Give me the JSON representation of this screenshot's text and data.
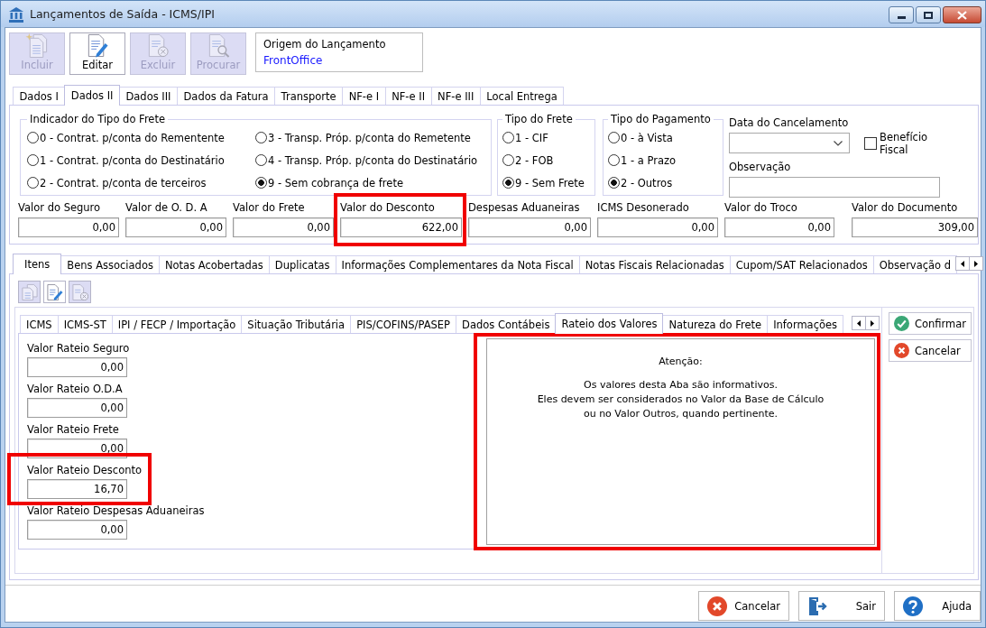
{
  "window": {
    "title": "Lançamentos de Saída - ICMS/IPI"
  },
  "toolbar": [
    {
      "label": "Incluir",
      "kind": "add",
      "disabled": true
    },
    {
      "label": "Editar",
      "kind": "edit",
      "disabled": false
    },
    {
      "label": "Excluir",
      "kind": "delete",
      "disabled": true
    },
    {
      "label": "Procurar",
      "kind": "search",
      "disabled": true
    }
  ],
  "origin": {
    "label": "Origem do Lançamento",
    "value": "FrontOffice"
  },
  "main_tabs": [
    {
      "label": "Dados I",
      "selected": false
    },
    {
      "label": "Dados II",
      "selected": true
    },
    {
      "label": "Dados III",
      "selected": false
    },
    {
      "label": "Dados da Fatura",
      "selected": false
    },
    {
      "label": "Transporte",
      "selected": false
    },
    {
      "label": "NF-e I",
      "selected": false
    },
    {
      "label": "NF-e II",
      "selected": false
    },
    {
      "label": "NF-e III",
      "selected": false
    },
    {
      "label": "Local Entrega",
      "selected": false
    }
  ],
  "freight_indicator": {
    "title": "Indicador do Tipo do Frete",
    "options": [
      {
        "label": "0 - Contrat. p/conta do Rementente",
        "selected": false
      },
      {
        "label": "1 - Contrat. p/conta do Destinatário",
        "selected": false
      },
      {
        "label": "2 - Contrat. p/conta de terceiros",
        "selected": false
      },
      {
        "label": "3 - Transp. Próp. p/conta do Remetente",
        "selected": false
      },
      {
        "label": "4 - Transp. Próp. p/conta do Destinatário",
        "selected": false
      },
      {
        "label": "9 - Sem cobrança de frete",
        "selected": true
      }
    ]
  },
  "freight_type": {
    "title": "Tipo do Frete",
    "options": [
      {
        "label": "1 - CIF",
        "selected": false
      },
      {
        "label": "2 - FOB",
        "selected": false
      },
      {
        "label": "9 - Sem Frete",
        "selected": true
      }
    ]
  },
  "payment_type": {
    "title": "Tipo do Pagamento",
    "options": [
      {
        "label": "0 - à Vista",
        "selected": false
      },
      {
        "label": "1 - a Prazo",
        "selected": false
      },
      {
        "label": "2 - Outros",
        "selected": true
      }
    ]
  },
  "cancel_date": {
    "label": "Data do Cancelamento"
  },
  "tax_benefit": {
    "label": "Benefício Fiscal",
    "checked": false
  },
  "observation": {
    "label": "Observação"
  },
  "totals": [
    {
      "label": "Valor do Seguro",
      "value": "0,00",
      "highlighted": false
    },
    {
      "label": "Valor de O. D. A",
      "value": "0,00",
      "highlighted": false
    },
    {
      "label": "Valor do Frete",
      "value": "0,00",
      "highlighted": false
    },
    {
      "label": "Valor do Desconto",
      "value": "622,00",
      "highlighted": true
    },
    {
      "label": "Despesas Aduaneiras",
      "value": "0,00",
      "highlighted": false
    },
    {
      "label": "ICMS Desonerado",
      "value": "0,00",
      "highlighted": false
    },
    {
      "label": "Valor do Troco",
      "value": "0,00",
      "highlighted": false
    },
    {
      "label": "Valor do Documento",
      "value": "309,00",
      "highlighted": false
    }
  ],
  "item_tabs": [
    {
      "label": "Itens",
      "selected": true
    },
    {
      "label": "Bens Associados",
      "selected": false
    },
    {
      "label": "Notas Acobertadas",
      "selected": false
    },
    {
      "label": "Duplicatas",
      "selected": false
    },
    {
      "label": "Informações Complementares da Nota Fiscal",
      "selected": false
    },
    {
      "label": "Notas Fiscais Relacionadas",
      "selected": false
    },
    {
      "label": "Cupom/SAT Relacionados",
      "selected": false
    },
    {
      "label": "Observação d",
      "selected": false
    }
  ],
  "item_toolbar": [
    {
      "kind": "add",
      "disabled": true
    },
    {
      "kind": "edit",
      "disabled": false
    },
    {
      "kind": "delete",
      "disabled": true
    }
  ],
  "tax_tabs": [
    {
      "label": "ICMS",
      "selected": false
    },
    {
      "label": "ICMS-ST",
      "selected": false
    },
    {
      "label": "IPI / FECP / Importação",
      "selected": false
    },
    {
      "label": "Situação Tributária",
      "selected": false
    },
    {
      "label": "PIS/COFINS/PASEP",
      "selected": false
    },
    {
      "label": "Dados Contábeis",
      "selected": false
    },
    {
      "label": "Rateio dos Valores",
      "selected": true
    },
    {
      "label": "Natureza do Frete",
      "selected": false
    },
    {
      "label": "Informações",
      "selected": false
    }
  ],
  "apportionment": [
    {
      "label": "Valor Rateio Seguro",
      "value": "0,00",
      "highlighted": false
    },
    {
      "label": "Valor Rateio O.D.A",
      "value": "0,00",
      "highlighted": false
    },
    {
      "label": "Valor Rateio Frete",
      "value": "0,00",
      "highlighted": false
    },
    {
      "label": "Valor Rateio Desconto",
      "value": "16,70",
      "highlighted": true
    },
    {
      "label": "Valor Rateio Despesas Aduaneiras",
      "value": "0,00",
      "highlighted": false
    }
  ],
  "notice": {
    "heading": "Atenção:",
    "text": "Os valores desta Aba são informativos.\nEles devem ser considerados no Valor da Base de Cálculo\nou no Valor Outros, quando pertinente.",
    "highlighted": true
  },
  "side_buttons": [
    {
      "label": "Confirmar",
      "kind": "confirm"
    },
    {
      "label": "Cancelar",
      "kind": "cancel"
    }
  ],
  "footer_buttons": [
    {
      "label": "Cancelar",
      "kind": "cancel"
    },
    {
      "label": "Sair",
      "kind": "exit"
    },
    {
      "label": "Ajuda",
      "kind": "help"
    }
  ]
}
